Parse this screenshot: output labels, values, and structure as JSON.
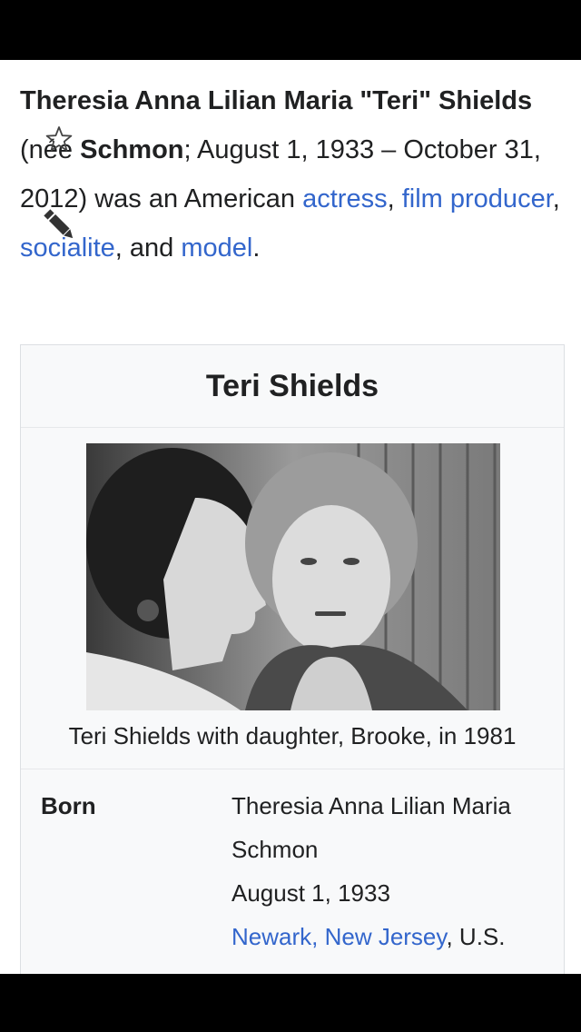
{
  "article": {
    "full_name": "Theresia Anna Lilian Maria \"Teri\" Shields",
    "nee_open": " (née ",
    "birth_surname": "Schmon",
    "dates": "; August 1, 1933 – October 31, 2012) was an American ",
    "link_actress": "actress",
    "sep1": ", ",
    "link_film_producer": "film producer",
    "sep2": ", ",
    "link_socialite": "socialite",
    "sep3": ", and ",
    "link_model": "model",
    "end": "."
  },
  "icons": {
    "star": "star-icon",
    "pencil": "pencil-icon"
  },
  "infobox": {
    "title": "Teri Shields",
    "caption": "Teri Shields with daughter, Brooke, in 1981",
    "born_label": "Born",
    "born_name_line1": "Theresia Anna Lilian Maria",
    "born_name_line2": "Schmon",
    "born_date": "August 1, 1933",
    "born_place_link": "Newark, New Jersey",
    "born_place_rest": ", U.S."
  },
  "colors": {
    "link": "#3366cc",
    "text": "#202122",
    "infobox_bg": "#f8f9fa"
  }
}
